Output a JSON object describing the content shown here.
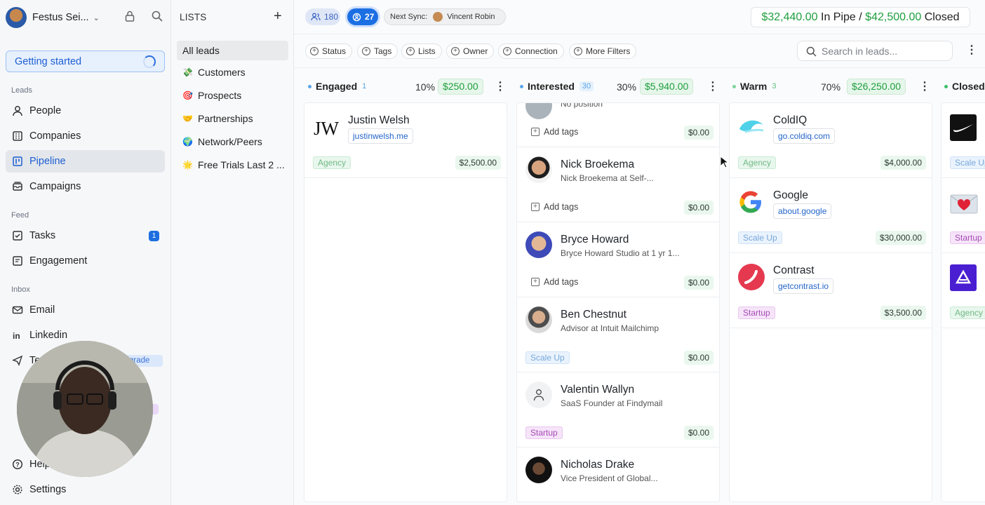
{
  "user": {
    "name": "Festus Sei..."
  },
  "sidebar": {
    "getting_started": "Getting started",
    "sections": {
      "leads": "Leads",
      "feed": "Feed",
      "inbox": "Inbox"
    },
    "items": [
      {
        "label": "People",
        "icon": "person-icon"
      },
      {
        "label": "Companies",
        "icon": "building-icon"
      },
      {
        "label": "Pipeline",
        "icon": "kanban-icon",
        "active": true
      },
      {
        "label": "Campaigns",
        "icon": "mail-stack-icon"
      },
      {
        "label": "Tasks",
        "icon": "checkbox-icon",
        "badge": "1"
      },
      {
        "label": "Engagement",
        "icon": "chat-icon"
      },
      {
        "label": "Email",
        "icon": "envelope-icon"
      },
      {
        "label": "Linkedin",
        "icon": "linkedin-icon"
      },
      {
        "label": "Te",
        "icon": "send-icon"
      },
      {
        "label": "Help",
        "icon": "help-icon"
      },
      {
        "label": "Settings",
        "icon": "gear-icon"
      }
    ],
    "upgrade": "grade"
  },
  "lists": {
    "title": "LISTS",
    "items": [
      {
        "label": "All leads",
        "emoji": ""
      },
      {
        "label": "Customers",
        "emoji": "💸"
      },
      {
        "label": "Prospects",
        "emoji": "🎯"
      },
      {
        "label": "Partnerships",
        "emoji": "🤝"
      },
      {
        "label": "Network/Peers",
        "emoji": "🌍"
      },
      {
        "label": "Free Trials Last 2 ...",
        "emoji": "🌟"
      }
    ]
  },
  "header": {
    "people_count": "180",
    "sync_count": "27",
    "next_sync_label": "Next Sync:",
    "next_sync_user": "Vincent Robin",
    "in_pipe_amount": "$32,440.00",
    "in_pipe_label": "In Pipe",
    "separator": "/",
    "closed_amount": "$42,500.00",
    "closed_label": "Closed",
    "search_placeholder": "Search in leads..."
  },
  "filters": [
    "Status",
    "Tags",
    "Lists",
    "Owner",
    "Connection",
    "More Filters"
  ],
  "columns": [
    {
      "name": "Engaged",
      "count": "1",
      "pct": "10%",
      "amount": "$250.00"
    },
    {
      "name": "Interested",
      "count": "30",
      "pct": "30%",
      "amount": "$5,940.00"
    },
    {
      "name": "Warm",
      "count": "3",
      "pct": "70%",
      "amount": "$26,250.00"
    },
    {
      "name": "Closed"
    }
  ],
  "engaged_cards": [
    {
      "name": "Justin Welsh",
      "link": "justinwelsh.me",
      "tag": "Agency",
      "value": "$2,500.00"
    }
  ],
  "interested_cards": [
    {
      "name": "",
      "sub": "No position",
      "add_tags": "Add tags",
      "value": "$0.00"
    },
    {
      "name": "Nick Broekema",
      "sub": "Nick Broekema at Self-...",
      "add_tags": "Add tags",
      "value": "$0.00"
    },
    {
      "name": "Bryce Howard",
      "sub": "Bryce Howard Studio at 1 yr 1...",
      "add_tags": "Add tags",
      "value": "$0.00"
    },
    {
      "name": "Ben Chestnut",
      "sub": "Advisor at Intuit Mailchimp",
      "tag": "Scale Up",
      "value": "$0.00"
    },
    {
      "name": "Valentin Wallyn",
      "sub": "SaaS Founder at Findymail",
      "tag": "Startup",
      "value": "$0.00"
    },
    {
      "name": "Nicholas Drake",
      "sub": "Vice President of Global..."
    }
  ],
  "warm_cards": [
    {
      "name": "ColdIQ",
      "link": "go.coldiq.com",
      "tag": "Agency",
      "value": "$4,000.00"
    },
    {
      "name": "Google",
      "link": "about.google",
      "tag": "Scale Up",
      "value": "$30,000.00"
    },
    {
      "name": "Contrast",
      "link": "getcontrast.io",
      "tag": "Startup",
      "value": "$3,500.00"
    }
  ],
  "closed_tags": [
    "Scale Up",
    "Startup",
    "Agency"
  ],
  "colors": {
    "accent": "#1d6fe0",
    "green": "#1e9e3e"
  }
}
